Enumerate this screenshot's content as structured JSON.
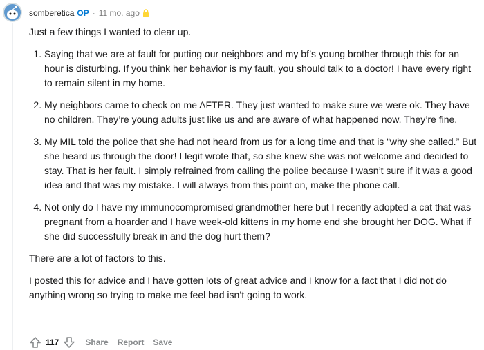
{
  "comment": {
    "username": "somberetica",
    "op_badge": "OP",
    "separator": "·",
    "timestamp": "11 mo. ago",
    "intro": "Just a few things I wanted to clear up.",
    "points": [
      "Saying that we are at fault for putting our neighbors and my bf’s young brother through this for an hour is disturbing. If you think her behavior is my fault, you should talk to a doctor! I have every right to remain silent in my home.",
      "My neighbors came to check on me AFTER. They just wanted to make sure we were ok. They have no children. They’re young adults just like us and are aware of what happened now. They’re fine.",
      "My MIL told the police that she had not heard from us for a long time and that is “why she called.” But she heard us through the door! I legit wrote that, so she knew she was not welcome and decided to stay. That is her fault. I simply refrained from calling the police because I wasn’t sure if it was a good idea and that was my mistake. I will always from this point on, make the phone call.",
      "Not only do I have my immunocompromised grandmother here but I recently adopted a cat that was pregnant from a hoarder and I have week-old kittens in my home end she brought her DOG. What if she did successfully break in and the dog hurt them?"
    ],
    "paragraph_factors": "There are a lot of factors to this.",
    "paragraph_closing": "I posted this for advice and I have gotten lots of great advice and I know for a fact that I did not do anything wrong so trying to make me feel bad isn’t going to work."
  },
  "actions": {
    "vote_count": "117",
    "share_label": "Share",
    "report_label": "Report",
    "save_label": "Save"
  },
  "colors": {
    "op_badge": "#0079d3",
    "lock": "#ffd635",
    "muted": "#878a8c",
    "avatar_blue": "#5f99cf"
  },
  "icons": {
    "avatar": "snoo-avatar",
    "lock": "lock-icon",
    "upvote": "upvote-arrow-icon",
    "downvote": "downvote-arrow-icon"
  }
}
